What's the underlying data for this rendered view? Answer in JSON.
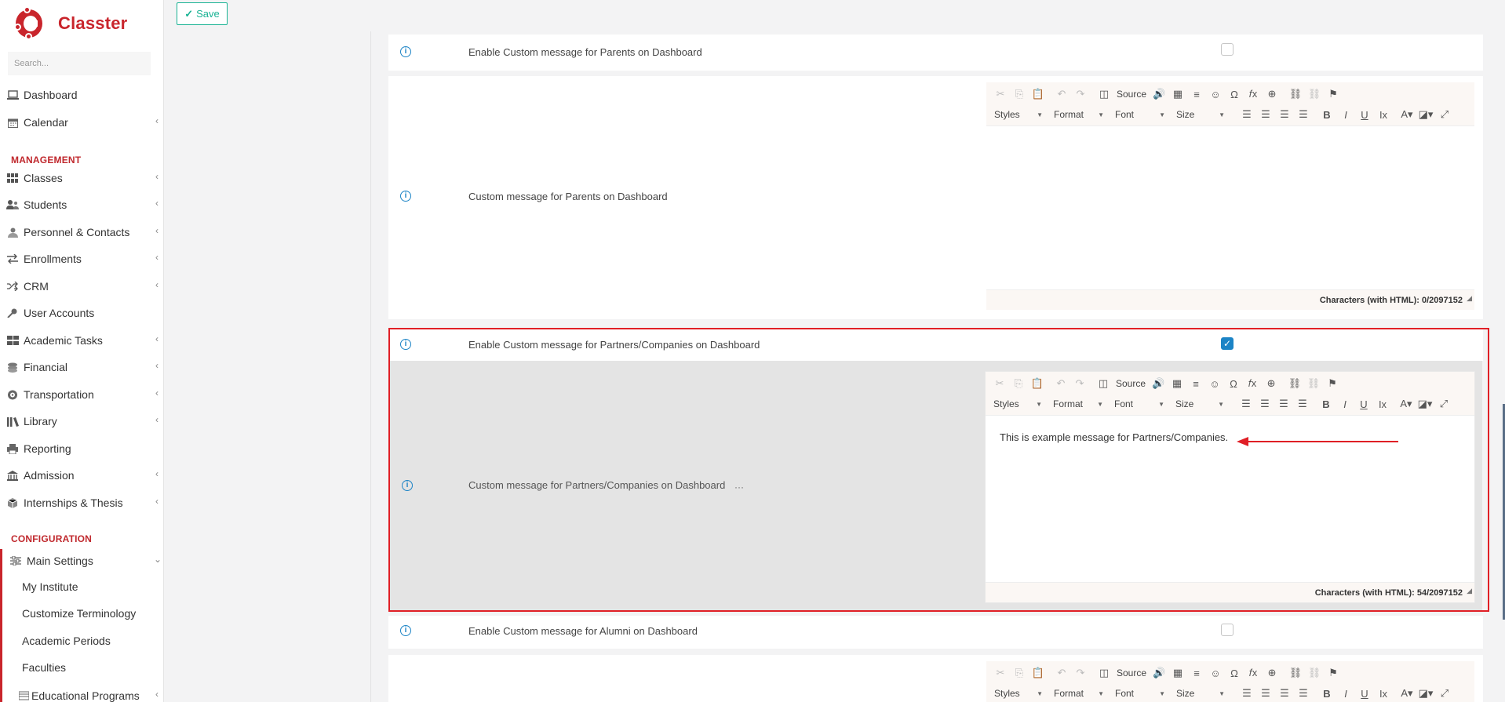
{
  "app": {
    "name": "Classter"
  },
  "toolbar": {
    "save_label": "Save"
  },
  "sidebar": {
    "search_placeholder": "Search...",
    "items_top": [
      {
        "label": "Dashboard",
        "icon": "laptop-icon",
        "chevron": false
      },
      {
        "label": "Calendar",
        "icon": "calendar-icon",
        "chevron": true
      }
    ],
    "management_heading": "MANAGEMENT",
    "management_items": [
      {
        "label": "Classes",
        "icon": "grid-icon",
        "chevron": true
      },
      {
        "label": "Students",
        "icon": "users-icon",
        "chevron": true
      },
      {
        "label": "Personnel & Contacts",
        "icon": "person-icon",
        "chevron": true
      },
      {
        "label": "Enrollments",
        "icon": "swap-icon",
        "chevron": true
      },
      {
        "label": "CRM",
        "icon": "shuffle-icon",
        "chevron": true
      },
      {
        "label": "User Accounts",
        "icon": "key-icon",
        "chevron": false
      },
      {
        "label": "Academic Tasks",
        "icon": "tasks-icon",
        "chevron": true
      },
      {
        "label": "Financial",
        "icon": "money-icon",
        "chevron": true
      },
      {
        "label": "Transportation",
        "icon": "bus-icon",
        "chevron": true
      },
      {
        "label": "Library",
        "icon": "books-icon",
        "chevron": true
      },
      {
        "label": "Reporting",
        "icon": "print-icon",
        "chevron": false
      },
      {
        "label": "Admission",
        "icon": "bank-icon",
        "chevron": true
      },
      {
        "label": "Internships & Thesis",
        "icon": "cube-icon",
        "chevron": true
      }
    ],
    "configuration_heading": "CONFIGURATION",
    "main_settings": {
      "label": "Main Settings",
      "icon": "sliders-icon"
    },
    "sub_items": [
      "My Institute",
      "Customize Terminology",
      "Academic Periods",
      "Faculties"
    ],
    "educational_programs": "Educational Programs"
  },
  "settings": {
    "row1_label": "Enable Custom message for Parents on Dashboard",
    "row2_label": "Custom message for Parents on Dashboard",
    "row3_label": "Enable Custom message for Partners/Companies on Dashboard",
    "row4_label": "Custom message for Partners/Companies on Dashboard",
    "row4_ellipsis": "···",
    "row5_label": "Enable Custom message for Alumni on Dashboard",
    "row1_checked": false,
    "row3_checked": true,
    "row5_checked": false
  },
  "editor": {
    "source_label": "Source",
    "styles_label": "Styles",
    "format_label": "Format",
    "font_label": "Font",
    "size_label": "Size",
    "parents_counter": "Characters (with HTML): 0/2097152",
    "partners_counter": "Characters (with HTML): 54/2097152",
    "partners_content": "This is example message for Partners/Companies."
  },
  "colors": {
    "brand": "#c9252c",
    "accent": "#1c84c6",
    "save": "#1ab394",
    "highlight": "#e01f26"
  }
}
